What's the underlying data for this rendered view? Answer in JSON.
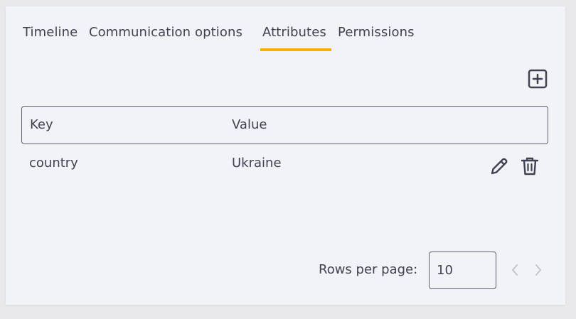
{
  "tabs": [
    {
      "label": "Timeline"
    },
    {
      "label": "Communication options"
    },
    {
      "label": "Attributes"
    },
    {
      "label": "Permissions"
    }
  ],
  "active_tab": "Attributes",
  "accent_color": "#f0b400",
  "table": {
    "columns": [
      "Key",
      "Value"
    ],
    "rows": [
      {
        "key": "country",
        "value": "Ukraine"
      }
    ]
  },
  "icons": {
    "add": "plus-square-icon",
    "edit": "pencil-icon",
    "delete": "trash-icon",
    "prev": "chevron-left-icon",
    "next": "chevron-right-icon"
  },
  "pagination": {
    "rows_per_page_label": "Rows per page:",
    "rows_per_page_value": "10"
  }
}
